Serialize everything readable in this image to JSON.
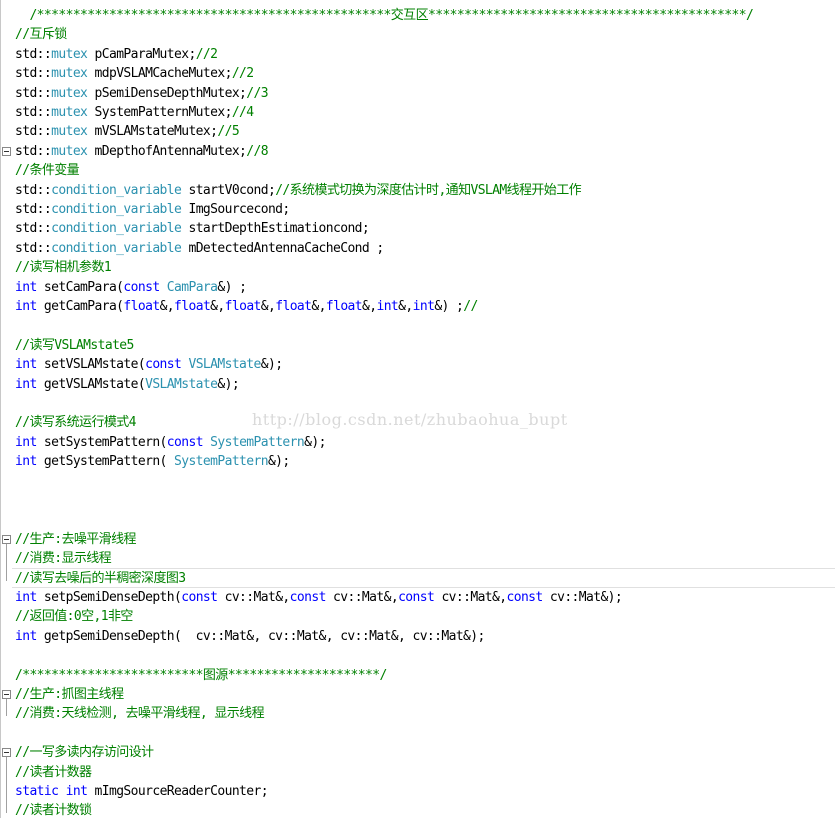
{
  "editor": {
    "lines": [
      {
        "row": 0,
        "segments": [
          {
            "t": "cm",
            "v": "  /*************************************************交互区********************************************/"
          }
        ]
      },
      {
        "row": 1,
        "segments": [
          {
            "t": "cm",
            "v": "//互斥锁"
          }
        ]
      },
      {
        "row": 2,
        "segments": [
          {
            "t": "tx",
            "v": "std::"
          },
          {
            "t": "ty",
            "v": "mutex"
          },
          {
            "t": "tx",
            "v": " pCamParaMutex;"
          },
          {
            "t": "cm",
            "v": "//2"
          }
        ]
      },
      {
        "row": 3,
        "segments": [
          {
            "t": "tx",
            "v": "std::"
          },
          {
            "t": "ty",
            "v": "mutex"
          },
          {
            "t": "tx",
            "v": " mdpVSLAMCacheMutex;"
          },
          {
            "t": "cm",
            "v": "//2"
          }
        ]
      },
      {
        "row": 4,
        "segments": [
          {
            "t": "tx",
            "v": "std::"
          },
          {
            "t": "ty",
            "v": "mutex"
          },
          {
            "t": "tx",
            "v": " pSemiDenseDepthMutex;"
          },
          {
            "t": "cm",
            "v": "//3"
          }
        ]
      },
      {
        "row": 5,
        "segments": [
          {
            "t": "tx",
            "v": "std::"
          },
          {
            "t": "ty",
            "v": "mutex"
          },
          {
            "t": "tx",
            "v": " SystemPatternMutex;"
          },
          {
            "t": "cm",
            "v": "//4"
          }
        ]
      },
      {
        "row": 6,
        "segments": [
          {
            "t": "tx",
            "v": "std::"
          },
          {
            "t": "ty",
            "v": "mutex"
          },
          {
            "t": "tx",
            "v": " mVSLAMstateMutex;"
          },
          {
            "t": "cm",
            "v": "//5"
          }
        ]
      },
      {
        "row": 7,
        "segments": [
          {
            "t": "tx",
            "v": "std::"
          },
          {
            "t": "ty",
            "v": "mutex"
          },
          {
            "t": "tx",
            "v": " mDepthofAntennaMutex;"
          },
          {
            "t": "cm",
            "v": "//8"
          }
        ]
      },
      {
        "row": 8,
        "segments": [
          {
            "t": "cm",
            "v": "//条件变量"
          }
        ]
      },
      {
        "row": 9,
        "segments": [
          {
            "t": "tx",
            "v": "std::"
          },
          {
            "t": "ty",
            "v": "condition_variable"
          },
          {
            "t": "tx",
            "v": " startV0cond;"
          },
          {
            "t": "cm",
            "v": "//系统模式切换为深度估计时,通知VSLAM线程开始工作"
          }
        ]
      },
      {
        "row": 10,
        "segments": [
          {
            "t": "tx",
            "v": "std::"
          },
          {
            "t": "ty",
            "v": "condition_variable"
          },
          {
            "t": "tx",
            "v": " ImgSourcecond;"
          }
        ]
      },
      {
        "row": 11,
        "segments": [
          {
            "t": "tx",
            "v": "std::"
          },
          {
            "t": "ty",
            "v": "condition_variable"
          },
          {
            "t": "tx",
            "v": " startDepthEstimationcond;"
          }
        ]
      },
      {
        "row": 12,
        "segments": [
          {
            "t": "tx",
            "v": "std::"
          },
          {
            "t": "ty",
            "v": "condition_variable"
          },
          {
            "t": "tx",
            "v": " mDetectedAntennaCacheCond ;"
          }
        ]
      },
      {
        "row": 13,
        "segments": [
          {
            "t": "cm",
            "v": "//读写相机参数1"
          }
        ]
      },
      {
        "row": 14,
        "segments": [
          {
            "t": "kw",
            "v": "int"
          },
          {
            "t": "tx",
            "v": " setCamPara("
          },
          {
            "t": "kw",
            "v": "const"
          },
          {
            "t": "tx",
            "v": " "
          },
          {
            "t": "ty",
            "v": "CamPara"
          },
          {
            "t": "tx",
            "v": "&) ;"
          }
        ]
      },
      {
        "row": 15,
        "segments": [
          {
            "t": "kw",
            "v": "int"
          },
          {
            "t": "tx",
            "v": " getCamPara("
          },
          {
            "t": "kw",
            "v": "float"
          },
          {
            "t": "tx",
            "v": "&,"
          },
          {
            "t": "kw",
            "v": "float"
          },
          {
            "t": "tx",
            "v": "&,"
          },
          {
            "t": "kw",
            "v": "float"
          },
          {
            "t": "tx",
            "v": "&,"
          },
          {
            "t": "kw",
            "v": "float"
          },
          {
            "t": "tx",
            "v": "&,"
          },
          {
            "t": "kw",
            "v": "float"
          },
          {
            "t": "tx",
            "v": "&,"
          },
          {
            "t": "kw",
            "v": "int"
          },
          {
            "t": "tx",
            "v": "&,"
          },
          {
            "t": "kw",
            "v": "int"
          },
          {
            "t": "tx",
            "v": "&) ;"
          },
          {
            "t": "cm",
            "v": "//"
          }
        ]
      },
      {
        "row": 16,
        "segments": []
      },
      {
        "row": 17,
        "segments": [
          {
            "t": "cm",
            "v": "//读写VSLAMstate5"
          }
        ]
      },
      {
        "row": 18,
        "segments": [
          {
            "t": "kw",
            "v": "int"
          },
          {
            "t": "tx",
            "v": " setVSLAMstate("
          },
          {
            "t": "kw",
            "v": "const"
          },
          {
            "t": "tx",
            "v": " "
          },
          {
            "t": "ty",
            "v": "VSLAMstate"
          },
          {
            "t": "tx",
            "v": "&);"
          }
        ]
      },
      {
        "row": 19,
        "segments": [
          {
            "t": "kw",
            "v": "int"
          },
          {
            "t": "tx",
            "v": " getVSLAMstate("
          },
          {
            "t": "ty",
            "v": "VSLAMstate"
          },
          {
            "t": "tx",
            "v": "&);"
          }
        ]
      },
      {
        "row": 20,
        "segments": []
      },
      {
        "row": 21,
        "segments": [
          {
            "t": "cm",
            "v": "//读写系统运行模式4"
          }
        ]
      },
      {
        "row": 22,
        "segments": [
          {
            "t": "kw",
            "v": "int"
          },
          {
            "t": "tx",
            "v": " setSystemPattern("
          },
          {
            "t": "kw",
            "v": "const"
          },
          {
            "t": "tx",
            "v": " "
          },
          {
            "t": "ty",
            "v": "SystemPattern"
          },
          {
            "t": "tx",
            "v": "&);"
          }
        ]
      },
      {
        "row": 23,
        "segments": [
          {
            "t": "kw",
            "v": "int"
          },
          {
            "t": "tx",
            "v": " getSystemPattern( "
          },
          {
            "t": "ty",
            "v": "SystemPattern"
          },
          {
            "t": "tx",
            "v": "&);"
          }
        ]
      },
      {
        "row": 24,
        "segments": []
      },
      {
        "row": 25,
        "segments": []
      },
      {
        "row": 26,
        "segments": []
      },
      {
        "row": 27,
        "segments": [
          {
            "t": "cm",
            "v": "//生产:去噪平滑线程"
          }
        ]
      },
      {
        "row": 28,
        "segments": [
          {
            "t": "cm",
            "v": "//消费:显示线程"
          }
        ]
      },
      {
        "row": 29,
        "segments": [
          {
            "t": "cm",
            "v": "//读写去噪后的半稠密深度图3"
          }
        ]
      },
      {
        "row": 30,
        "segments": [
          {
            "t": "kw",
            "v": "int"
          },
          {
            "t": "tx",
            "v": " setpSemiDenseDepth("
          },
          {
            "t": "kw",
            "v": "const"
          },
          {
            "t": "tx",
            "v": " cv::Mat&,"
          },
          {
            "t": "kw",
            "v": "const"
          },
          {
            "t": "tx",
            "v": " cv::Mat&,"
          },
          {
            "t": "kw",
            "v": "const"
          },
          {
            "t": "tx",
            "v": " cv::Mat&,"
          },
          {
            "t": "kw",
            "v": "const"
          },
          {
            "t": "tx",
            "v": " cv::Mat&);"
          }
        ]
      },
      {
        "row": 31,
        "segments": [
          {
            "t": "cm",
            "v": "//返回值:0空,1非空"
          }
        ]
      },
      {
        "row": 32,
        "segments": [
          {
            "t": "kw",
            "v": "int"
          },
          {
            "t": "tx",
            "v": " getpSemiDenseDepth(  cv::Mat&, cv::Mat&, cv::Mat&, cv::Mat&);"
          }
        ]
      },
      {
        "row": 33,
        "segments": []
      },
      {
        "row": 34,
        "segments": [
          {
            "t": "cm",
            "v": "/*************************图源*********************/"
          }
        ]
      },
      {
        "row": 35,
        "segments": [
          {
            "t": "cm",
            "v": "//生产:抓图主线程"
          }
        ]
      },
      {
        "row": 36,
        "segments": [
          {
            "t": "cm",
            "v": "//消费:天线检测, 去噪平滑线程, 显示线程"
          }
        ]
      },
      {
        "row": 37,
        "segments": []
      },
      {
        "row": 38,
        "segments": [
          {
            "t": "cm",
            "v": "//一写多读内存访问设计"
          }
        ]
      },
      {
        "row": 39,
        "segments": [
          {
            "t": "cm",
            "v": "//读者计数器"
          }
        ]
      },
      {
        "row": 40,
        "segments": [
          {
            "t": "kw",
            "v": "static"
          },
          {
            "t": "tx",
            "v": " "
          },
          {
            "t": "kw",
            "v": "int"
          },
          {
            "t": "tx",
            "v": " mImgSourceReaderCounter;"
          }
        ]
      },
      {
        "row": 41,
        "segments": [
          {
            "t": "cm",
            "v": "//读者计数锁"
          }
        ]
      }
    ],
    "watermark": "http://blog.csdn.net/zhubaohua_bupt",
    "fold_markers": [
      7,
      27,
      35,
      38
    ],
    "current_line_row": 29,
    "colors": {
      "comment": "#008000",
      "keyword": "#0000ff",
      "type": "#2b91af",
      "text": "#000000",
      "watermark": "#d9d9d9"
    }
  }
}
